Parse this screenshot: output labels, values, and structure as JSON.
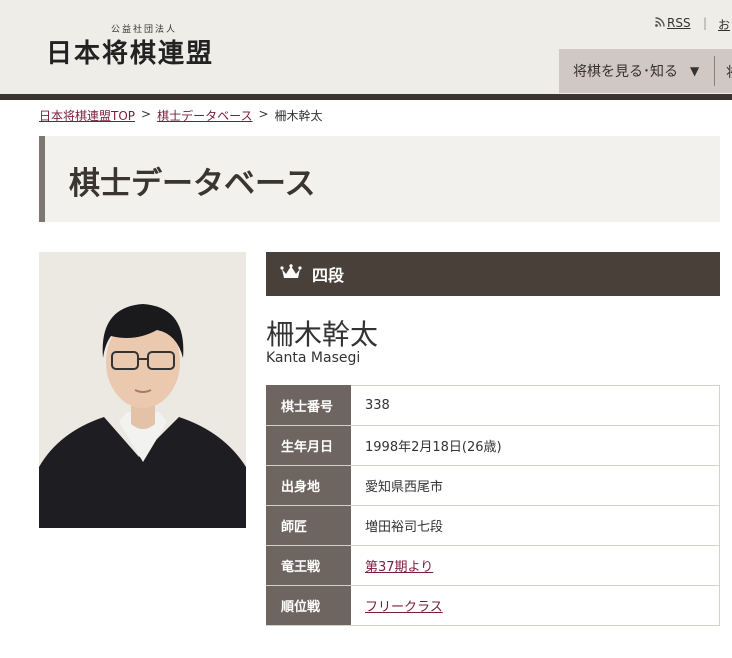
{
  "header": {
    "logo_sub": "公益社団法人",
    "logo_main": "日本将棋連盟",
    "rss_label": "RSS",
    "divider": "|",
    "link2": "お",
    "nav_item": "将棋を見る･知る",
    "nav_caret": "▼",
    "nav_next": "将"
  },
  "breadcrumb": {
    "home": "日本将棋連盟TOP",
    "sep1": ">",
    "section": "棋士データベース",
    "sep2": ">",
    "current": "柵木幹太"
  },
  "page_title": "棋士データベース",
  "profile": {
    "rank": "四段",
    "name": "柵木幹太",
    "name_en": "Kanta Masegi",
    "rows": [
      {
        "label": "棋士番号",
        "value": "338",
        "link": false
      },
      {
        "label": "生年月日",
        "value": "1998年2月18日(26歳)",
        "link": false
      },
      {
        "label": "出身地",
        "value": "愛知県西尾市",
        "link": false
      },
      {
        "label": "師匠",
        "value": "増田裕司七段",
        "link": false
      },
      {
        "label": "竜王戦",
        "value": "第37期より",
        "link": true
      },
      {
        "label": "順位戦",
        "value": "フリークラス",
        "link": true
      }
    ]
  },
  "colors": {
    "accent_link": "#7a1d3c",
    "rank_bar": "#4a403a",
    "table_header": "#6e6560"
  }
}
